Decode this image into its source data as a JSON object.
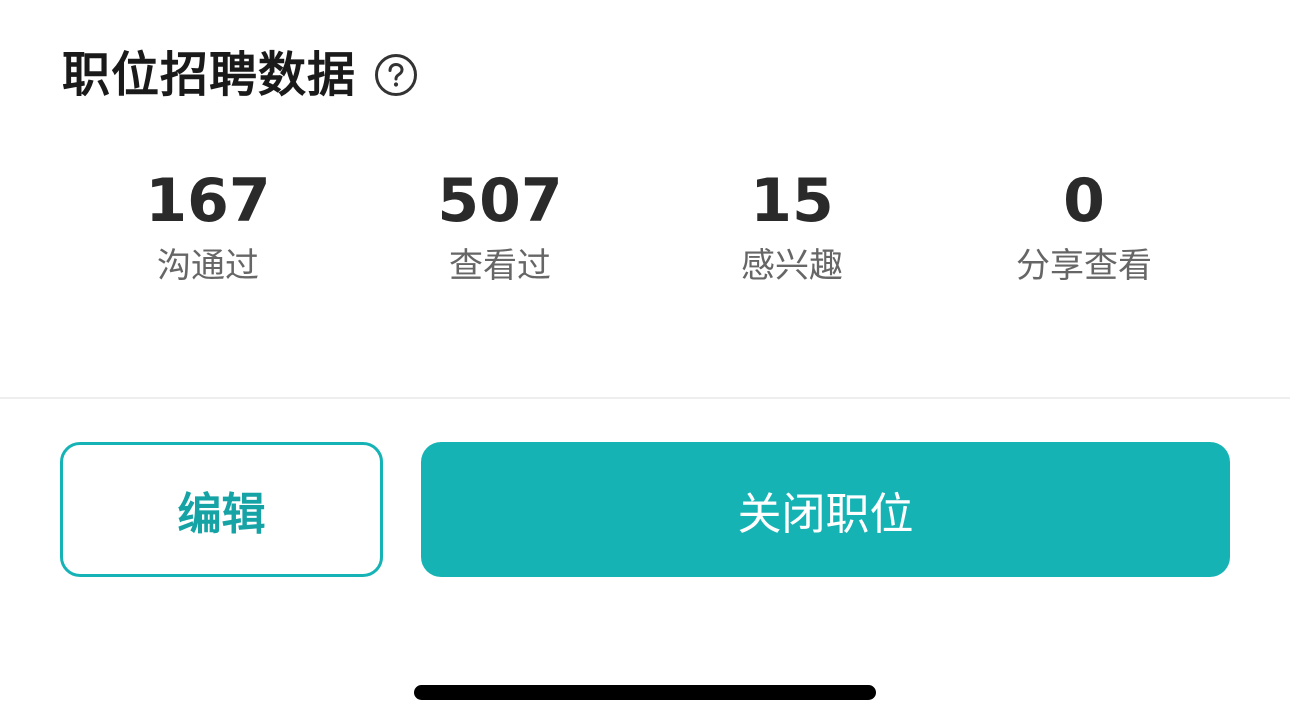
{
  "section": {
    "title": "职位招聘数据",
    "help_icon": "question-circle-icon"
  },
  "stats": [
    {
      "value": "167",
      "label": "沟通过"
    },
    {
      "value": "507",
      "label": "查看过"
    },
    {
      "value": "15",
      "label": "感兴趣"
    },
    {
      "value": "0",
      "label": "分享查看"
    }
  ],
  "actions": {
    "edit_label": "编辑",
    "close_label": "关闭职位"
  },
  "colors": {
    "accent": "#16b3b5",
    "title_text": "#1a1a1a",
    "label_text": "#666666"
  }
}
